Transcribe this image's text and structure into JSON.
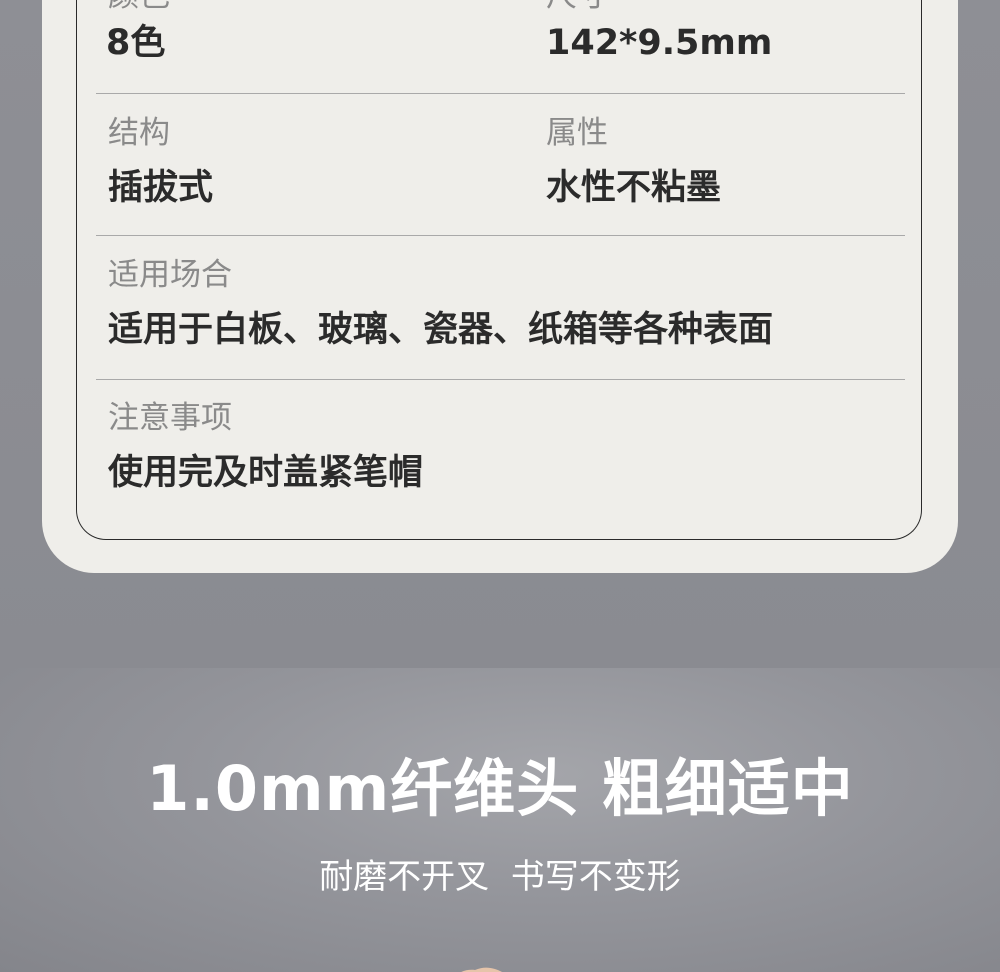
{
  "specs": {
    "color_label": "颜色",
    "color_value": "8色",
    "size_label": "尺寸",
    "size_value": "142*9.5mm",
    "structure_label": "结构",
    "structure_value": "插拔式",
    "property_label": "属性",
    "property_value": "水性不粘墨",
    "usage_label": "适用场合",
    "usage_value": "适用于白板、玻璃、瓷器、纸箱等各种表面",
    "notes_label": "注意事项",
    "notes_value": "使用完及时盖紧笔帽"
  },
  "feature": {
    "headline": "1.0mm纤维头 粗细适中",
    "subline": "耐磨不开叉  书写不变形"
  },
  "colors": {
    "card_bg": "#efeeea",
    "page_bg": "#8b8c92",
    "value_text": "#2b2b2b",
    "label_text": "#8a8a8a"
  }
}
